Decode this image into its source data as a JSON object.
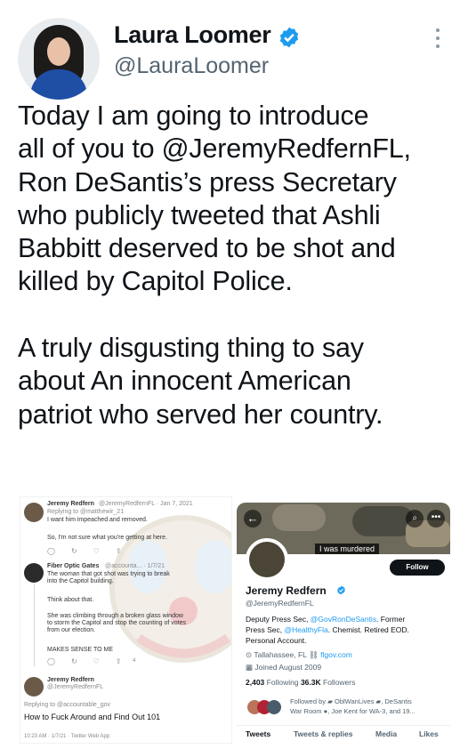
{
  "tweet": {
    "author_name": "Laura Loomer",
    "author_handle": "@LauraLoomer",
    "text": "Today I am going to introduce\nall of you to @JeremyRedfernFL,\nRon DeSantis’s press Secretary\nwho publicly tweeted that Ashli\nBabbitt deserved to be shot and\nkilled by Capitol Police.\n\nA truly disgusting thing to say\nabout An innocent American\npatriot who served her country.",
    "colors": {
      "accent": "#1d9bf0",
      "text": "#0f1419",
      "muted": "#536471"
    }
  },
  "left_screenshot": {
    "t1_header": "Jeremy Redfern",
    "t1_meta": "@JeremyRedfernFL · Jan 7, 2021",
    "t1_reply": "Replying to @matthewir_21",
    "t1_body": "I want him impeached and removed.",
    "t2_body": "So, I'm not sure what you're getting at here.",
    "t3_name": "Fiber Optic Gates",
    "t3_meta": "@accounta... · 1/7/21",
    "t3_body": "The woman that got shot was trying to break into the Capitol building.",
    "t4_body": "Think about that.",
    "t5_body": "She was climbing through a broken glass window to storm the Capitol and stop the counting of votes from our election.",
    "t6_body": "MAKES SENSE TO ME",
    "t6_count": "4",
    "t7_name": "Jeremy Redfern",
    "t7_handle": "@JeremyRedfernFL",
    "t7_reply": "Replying to @accountable_gov",
    "t7_body": "How to Fuck Around and Find Out 101",
    "t7_time": "10:23 AM · 1/7/21 · Twitter Web App"
  },
  "right_screenshot": {
    "banner_caption": "I was murdered",
    "follow_label": "Follow",
    "name": "Jeremy Redfern",
    "handle": "@JeremyRedfernFL",
    "bio_1": "Deputy Press Sec,",
    "bio_link_1": "@GovRonDeSantis",
    "bio_2": ". Former",
    "bio_3": "Press Sec,",
    "bio_link_2": "@HealthyFla",
    "bio_4": ". Chemist. Retired EOD.",
    "bio_5": "Personal Account.",
    "location": "Tallahassee, FL",
    "website": "flgov.com",
    "joined": "Joined August 2009",
    "following_count": "2,403",
    "following_label": "Following",
    "followers_count": "36.3K",
    "followers_label": "Followers",
    "followed_by_1": "Followed by",
    "followed_by_name1": "OblWanLives",
    "followed_by_name2": ", DeSantis",
    "followed_by_2": "War Room",
    "followed_by_3": ", Joe Kent for WA-3, and 19...",
    "tabs": [
      "Tweets",
      "Tweets & replies",
      "Media",
      "Likes"
    ]
  }
}
